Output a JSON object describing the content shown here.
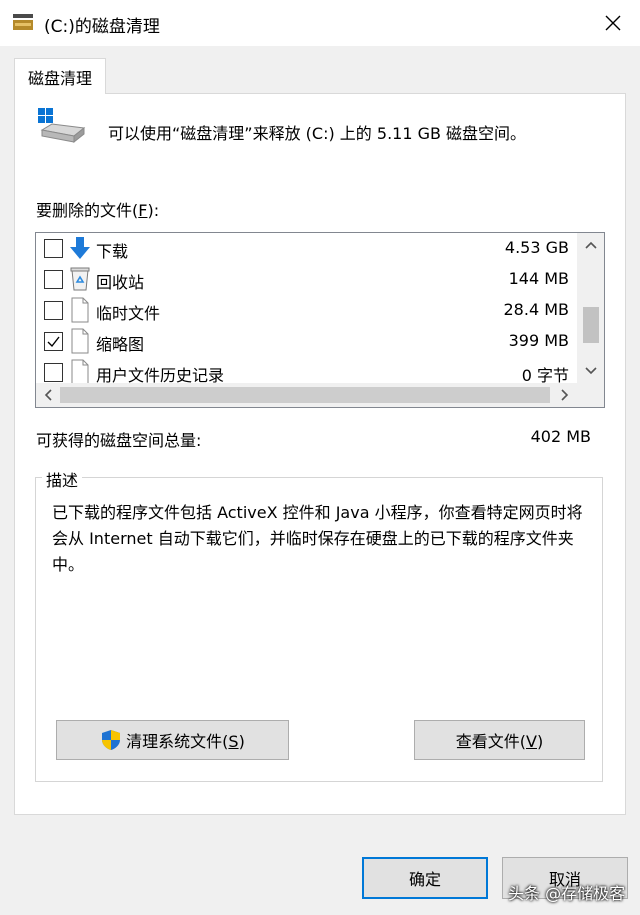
{
  "window": {
    "title": "(C:)的磁盘清理"
  },
  "tab": {
    "label": "磁盘清理"
  },
  "header": {
    "text": "可以使用“磁盘清理”来释放 (C:) 上的 5.11 GB 磁盘空间。"
  },
  "files": {
    "label": "要删除的文件(",
    "label_key": "F",
    "label_end": "):",
    "items": [
      {
        "name": "下载",
        "size": "4.53 GB",
        "checked": false,
        "icon": "download-arrow-icon"
      },
      {
        "name": "回收站",
        "size": "144 MB",
        "checked": false,
        "icon": "recycle-bin-icon"
      },
      {
        "name": "临时文件",
        "size": "28.4 MB",
        "checked": false,
        "icon": "file-icon"
      },
      {
        "name": "缩略图",
        "size": "399 MB",
        "checked": true,
        "icon": "file-icon"
      },
      {
        "name": "用户文件历史记录",
        "size": "0 字节",
        "checked": false,
        "icon": "file-icon"
      }
    ]
  },
  "total": {
    "label": "可获得的磁盘空间总量:",
    "value": "402 MB"
  },
  "description": {
    "legend": "描述",
    "text": "已下载的程序文件包括 ActiveX 控件和 Java 小程序，你查看特定网页时将会从 Internet 自动下载它们，并临时保存在硬盘上的已下载的程序文件夹中。"
  },
  "buttons": {
    "clean_system": "清理系统文件(",
    "clean_system_key": "S",
    "clean_system_end": ")",
    "view_files": "查看文件(",
    "view_files_key": "V",
    "view_files_end": ")",
    "ok": "确定",
    "cancel": "取消"
  },
  "watermark": "头条 @存储极客",
  "colors": {
    "accent": "#0078d7",
    "shield_blue": "#1e73d2",
    "shield_yellow": "#f7c400"
  }
}
